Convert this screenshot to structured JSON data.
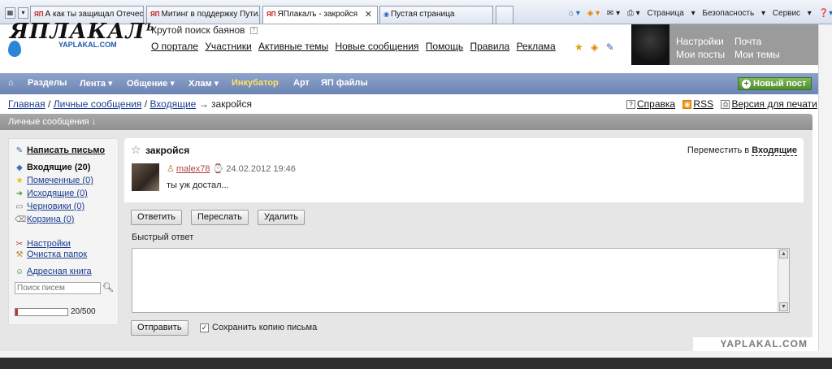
{
  "browser": {
    "tabs": [
      {
        "fav": "ЯП",
        "title": "А как ты защищал Отечес...",
        "active": false
      },
      {
        "fav": "ЯП",
        "title": "Митинг в поддержку Пути...",
        "active": false
      },
      {
        "fav": "ЯП",
        "title": "ЯПлакалъ - закройся",
        "active": true
      },
      {
        "fav": "",
        "title": "Пустая страница",
        "active": false
      }
    ],
    "close_glyph": "✕",
    "commands": {
      "page": "Страница",
      "security": "Безопасность",
      "tools": "Сервис",
      "more": "»"
    }
  },
  "header": {
    "logo_word": "ЯПЛАКАЛ",
    "logo_sup": "Ъ",
    "logo_domain": "YAPLAKAL.COM",
    "tagline": "Крутой поиск баянов",
    "tagline_mark": "?",
    "links": [
      "О портале",
      "Участники",
      "Активные темы",
      "Новые сообщения",
      "Помощь",
      "Правила",
      "Реклама"
    ],
    "user_links": {
      "settings": "Настройки",
      "mail": "Почта",
      "my_posts": "Мои посты",
      "my_topics": "Мои темы"
    }
  },
  "nav": {
    "home_icon": "⌂",
    "items": [
      {
        "label": "Разделы",
        "accent": false
      },
      {
        "label": "Лента ▾",
        "accent": false
      },
      {
        "label": "Общение ▾",
        "accent": false
      },
      {
        "label": "Хлам ▾",
        "accent": false
      },
      {
        "label": "Инкубатор",
        "accent": true
      },
      {
        "label": "Арт",
        "accent": false
      },
      {
        "label": "ЯП файлы",
        "accent": false
      }
    ],
    "new_post": "Новый пост"
  },
  "breadcrumb": {
    "home": "Главная",
    "sep": "/",
    "pm": "Личные сообщения",
    "inbox": "Входящие",
    "arrow": "→",
    "current": "закройся"
  },
  "tools": {
    "help": "Справка",
    "rss": "RSS",
    "print": "Версия для печати"
  },
  "section": {
    "title": "Личные сообщения ↓"
  },
  "sidebar": {
    "compose": "Написать письмо",
    "folders": [
      {
        "icon": "◆",
        "label": "Входящие (20)",
        "strong": true,
        "color": "#3b6fc0"
      },
      {
        "icon": "★",
        "label": "Помеченные (0)",
        "strong": false,
        "color": "#e8b90c"
      },
      {
        "icon": "➜",
        "label": "Исходящие (0)",
        "strong": false,
        "color": "#3c9b2f"
      },
      {
        "icon": "▭",
        "label": "Черновики (0)",
        "strong": false,
        "color": "#777777"
      },
      {
        "icon": "🗑",
        "label": "Корзина (0)",
        "strong": false,
        "color": "#777777"
      }
    ],
    "settings": "Настройки",
    "cleanup": "Очистка папок",
    "address_book": "Адресная книга",
    "search_placeholder": "Поиск писем",
    "quota_text": "20/500",
    "quota_fraction": 0.04
  },
  "message": {
    "subject": "закройся",
    "move_label": "Переместить в",
    "move_target": "Входящие",
    "author": "malex78",
    "date": "24.02.2012 19:46",
    "body": "ты уж достал..."
  },
  "actions": {
    "reply": "Ответить",
    "forward": "Переслать",
    "delete": "Удалить"
  },
  "quick_reply": {
    "label": "Быстрый ответ",
    "send": "Отправить",
    "save_copy": "Сохранить копию письма"
  },
  "footer": {
    "watermark": "YAPLAKAL.COM"
  }
}
